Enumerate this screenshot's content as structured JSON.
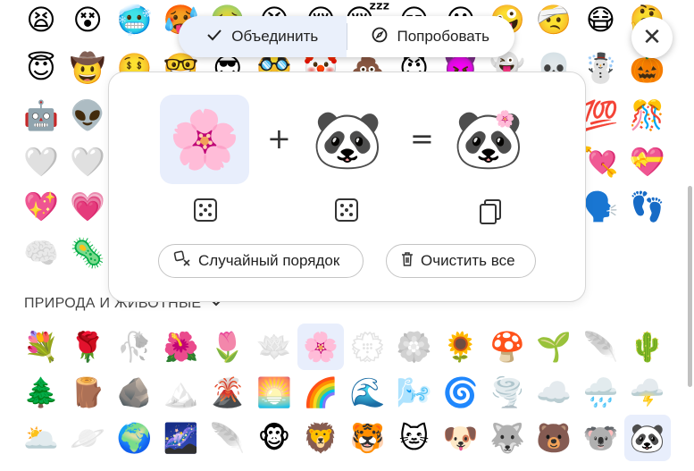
{
  "toolbar": {
    "merge_label": "Объединить",
    "try_label": "Попробовать",
    "close_glyph": "✕"
  },
  "mixer": {
    "first": "🌸",
    "second": "🐼",
    "result": "🐼",
    "result_badge": "🌸",
    "plus": "+",
    "equals": "=",
    "shuffle_label": "Случайный порядок",
    "clear_label": "Очистить все"
  },
  "section": {
    "title": "ПРИРОДА И ЖИВОТНЫЕ"
  },
  "rows": [
    [
      "😫",
      "😵",
      "🥶",
      "🥵",
      "🤢",
      "😣",
      "😌",
      "😴",
      "😑",
      "😐",
      "🤪",
      "🤕",
      "😷",
      "🤔"
    ],
    [
      "😇",
      "🤠",
      "🤑",
      "🤓",
      "😎",
      "🥸",
      "🤡",
      "💩",
      "😈",
      "👿",
      "👻",
      "💀",
      "☃️",
      "🎃"
    ],
    [
      "🤖",
      "👽",
      "",
      "",
      "",
      "",
      "",
      "",
      "",
      "",
      "",
      "",
      "💯",
      "🎊"
    ],
    [
      "🤍",
      "🤍",
      "",
      "",
      "",
      "",
      "",
      "",
      "",
      "",
      "",
      "",
      "💘",
      "💝"
    ],
    [
      "💖",
      "💗",
      "",
      "",
      "",
      "",
      "",
      "",
      "",
      "",
      "",
      "",
      "🗣️",
      "👣"
    ],
    [
      "🧠",
      "🦠",
      "",
      "",
      "",
      "",
      "",
      "",
      "",
      "",
      "",
      "",
      "",
      ""
    ],
    [
      "💐",
      "🌹",
      "🥀",
      "🌺",
      "🌷",
      "🪷",
      "🌸",
      "💮",
      "🏵️",
      "🌻",
      "🍄",
      "🌱",
      "🪶",
      "🌵"
    ],
    [
      "🌲",
      "🪵",
      "🪨",
      "🏔️",
      "🌋",
      "🌅",
      "🌈",
      "🌊",
      "🌬️",
      "🌀",
      "🌪️",
      "☁️",
      "🌧️",
      "🌩️"
    ],
    [
      "🌥️",
      "🪐",
      "🌍",
      "🌌",
      "🪶",
      "🐵",
      "🦁",
      "🐯",
      "🐱",
      "🐶",
      "🐺",
      "🐻",
      "🐨",
      "🐼"
    ]
  ],
  "dim_cells": [
    "5-0",
    "6-2",
    "6-5",
    "6-7",
    "6-8",
    "6-12",
    "7-3",
    "8-1",
    "8-4"
  ],
  "selected_cells": [
    "6-6",
    "8-13"
  ]
}
